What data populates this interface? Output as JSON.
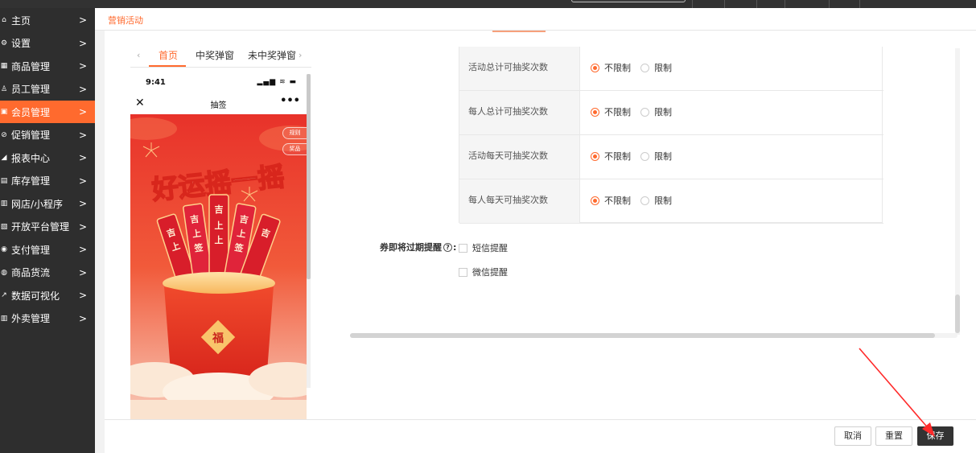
{
  "breadcrumb": "营销活动",
  "sidebar": {
    "items": [
      {
        "label": "主页",
        "icon": "home-icon",
        "glyph": "⌂"
      },
      {
        "label": "设置",
        "icon": "gear-icon",
        "glyph": "⚙"
      },
      {
        "label": "商品管理",
        "icon": "goods-icon",
        "glyph": "▦"
      },
      {
        "label": "员工管理",
        "icon": "staff-icon",
        "glyph": "♙"
      },
      {
        "label": "会员管理",
        "icon": "member-icon",
        "glyph": "▣",
        "active": true
      },
      {
        "label": "促销管理",
        "icon": "promo-icon",
        "glyph": "⊘"
      },
      {
        "label": "报表中心",
        "icon": "report-icon",
        "glyph": "◢"
      },
      {
        "label": "库存管理",
        "icon": "stock-icon",
        "glyph": "▤"
      },
      {
        "label": "网店/小程序",
        "icon": "shop-icon",
        "glyph": "▥"
      },
      {
        "label": "开放平台管理",
        "icon": "platform-icon",
        "glyph": "▧"
      },
      {
        "label": "支付管理",
        "icon": "pay-icon",
        "glyph": "◉"
      },
      {
        "label": "商品货流",
        "icon": "flow-icon",
        "glyph": "◍"
      },
      {
        "label": "数据可视化",
        "icon": "chart-icon",
        "glyph": "↗"
      },
      {
        "label": "外卖管理",
        "icon": "takeaway-icon",
        "glyph": "▥"
      }
    ],
    "chevron": ">"
  },
  "preview": {
    "tabs": [
      "首页",
      "中奖弹窗",
      "未中奖弹窗"
    ],
    "active_tab": 0,
    "arrow_left": "‹",
    "arrow_right": "›",
    "phone": {
      "time": "9:41",
      "status_glyphs": "▂▄▆ ≋ ▬",
      "close_glyph": "✕",
      "title": "抽签",
      "more_glyph": "•••",
      "rules_label": "规则",
      "prizes_label": "奖品",
      "banner_text": "好运摇一摇",
      "stick_chars": [
        "吉",
        "上",
        "上",
        "签"
      ],
      "bucket_char": "福"
    }
  },
  "settings": {
    "rows": [
      {
        "label": "活动总计可抽奖次数",
        "options": [
          "不限制",
          "限制"
        ],
        "selected": 0
      },
      {
        "label": "每人总计可抽奖次数",
        "options": [
          "不限制",
          "限制"
        ],
        "selected": 0
      },
      {
        "label": "活动每天可抽奖次数",
        "options": [
          "不限制",
          "限制"
        ],
        "selected": 0
      },
      {
        "label": "每人每天可抽奖次数",
        "options": [
          "不限制",
          "限制"
        ],
        "selected": 0
      }
    ]
  },
  "expiry": {
    "label": "券即将过期提醒",
    "help_glyph": "?",
    "colon": ":",
    "options": [
      {
        "label": "短信提醒",
        "checked": false
      },
      {
        "label": "微信提醒",
        "checked": false
      }
    ]
  },
  "footer": {
    "cancel_label": "取消",
    "reset_label": "重置",
    "save_label": "保存"
  },
  "colors": {
    "accent": "#ff6a2e",
    "sidebar_bg": "#2e2e2e",
    "primary_button": "#333333",
    "annotation_arrow": "#ff2a2a"
  }
}
